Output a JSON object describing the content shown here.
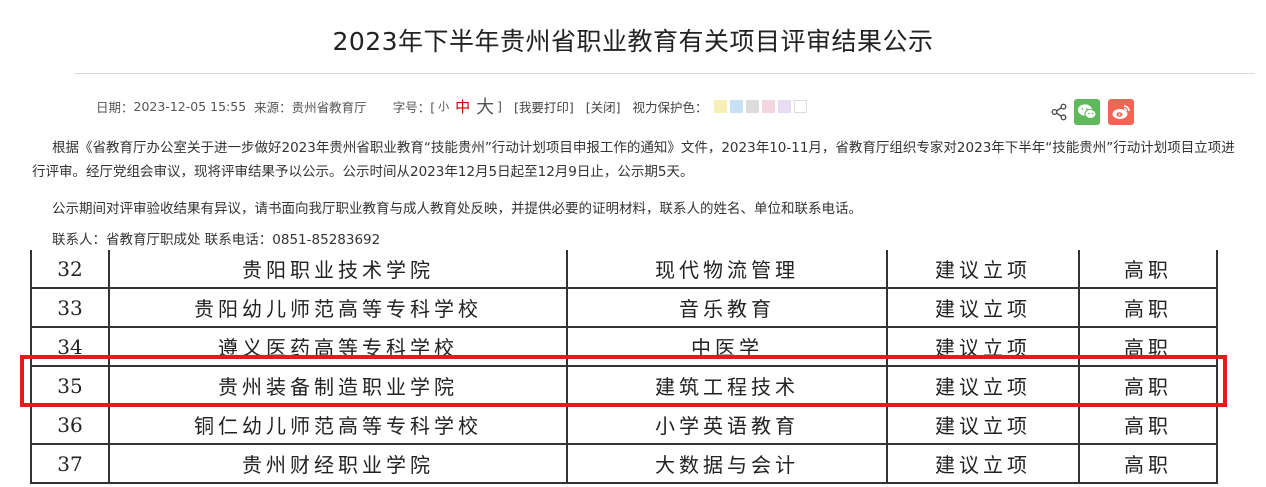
{
  "title": "2023年下半年贵州省职业教育有关项目评审结果公示",
  "meta": {
    "date_label": "日期：",
    "date_value": "2023-12-05 15:55",
    "source_label": "来源：",
    "source_value": "贵州省教育厅",
    "fontsize_label": "字号：[",
    "fontsize_small": "小",
    "fontsize_medium": "中",
    "fontsize_large": "大",
    "fontsize_close": "]",
    "print_label": "[我要打印]",
    "close_label": "[关闭]",
    "eye_label": "视力保护色：",
    "eye_colors": [
      "#f7efb8",
      "#c7e1f3",
      "#dcdcdc",
      "#f4d6e0",
      "#e7dcf3",
      "#ffffff"
    ]
  },
  "share": {
    "share_icon": "share-icon",
    "wechat_icon": "wechat-icon",
    "weibo_icon": "weibo-icon",
    "wechat_color": "#5fb85a",
    "weibo_color": "#f06553"
  },
  "body": {
    "p1": "根据《省教育厅办公室关于进一步做好2023年贵州省职业教育“技能贵州”行动计划项目申报工作的通知》文件，2023年10-11月，省教育厅组织专家对2023年下半年“技能贵州”行动计划项目立项进行评审。经厅党组会审议，现将评审结果予以公示。公示时间从2023年12月5日起至12月9日止，公示期5天。",
    "p2": "公示期间对评审验收结果有异议，请书面向我厅职业教育与成人教育处反映，并提供必要的证明材料，联系人的姓名、单位和联系电话。",
    "p3": "联系人：省教育厅职成处   联系电话：0851-85283692"
  },
  "table": {
    "rows": [
      {
        "no": "32",
        "school": "贵阳职业技术学院",
        "major": "现代物流管理",
        "status": "建议立项",
        "level": "高职"
      },
      {
        "no": "33",
        "school": "贵阳幼儿师范高等专科学校",
        "major": "音乐教育",
        "status": "建议立项",
        "level": "高职"
      },
      {
        "no": "34",
        "school": "遵义医药高等专科学校",
        "major": "中医学",
        "status": "建议立项",
        "level": "高职"
      },
      {
        "no": "35",
        "school": "贵州装备制造职业学院",
        "major": "建筑工程技术",
        "status": "建议立项",
        "level": "高职"
      },
      {
        "no": "36",
        "school": "铜仁幼儿师范高等专科学校",
        "major": "小学英语教育",
        "status": "建议立项",
        "level": "高职"
      },
      {
        "no": "37",
        "school": "贵州财经职业学院",
        "major": "大数据与会计",
        "status": "建议立项",
        "level": "高职"
      }
    ],
    "highlight_color": "#e21b1b"
  }
}
